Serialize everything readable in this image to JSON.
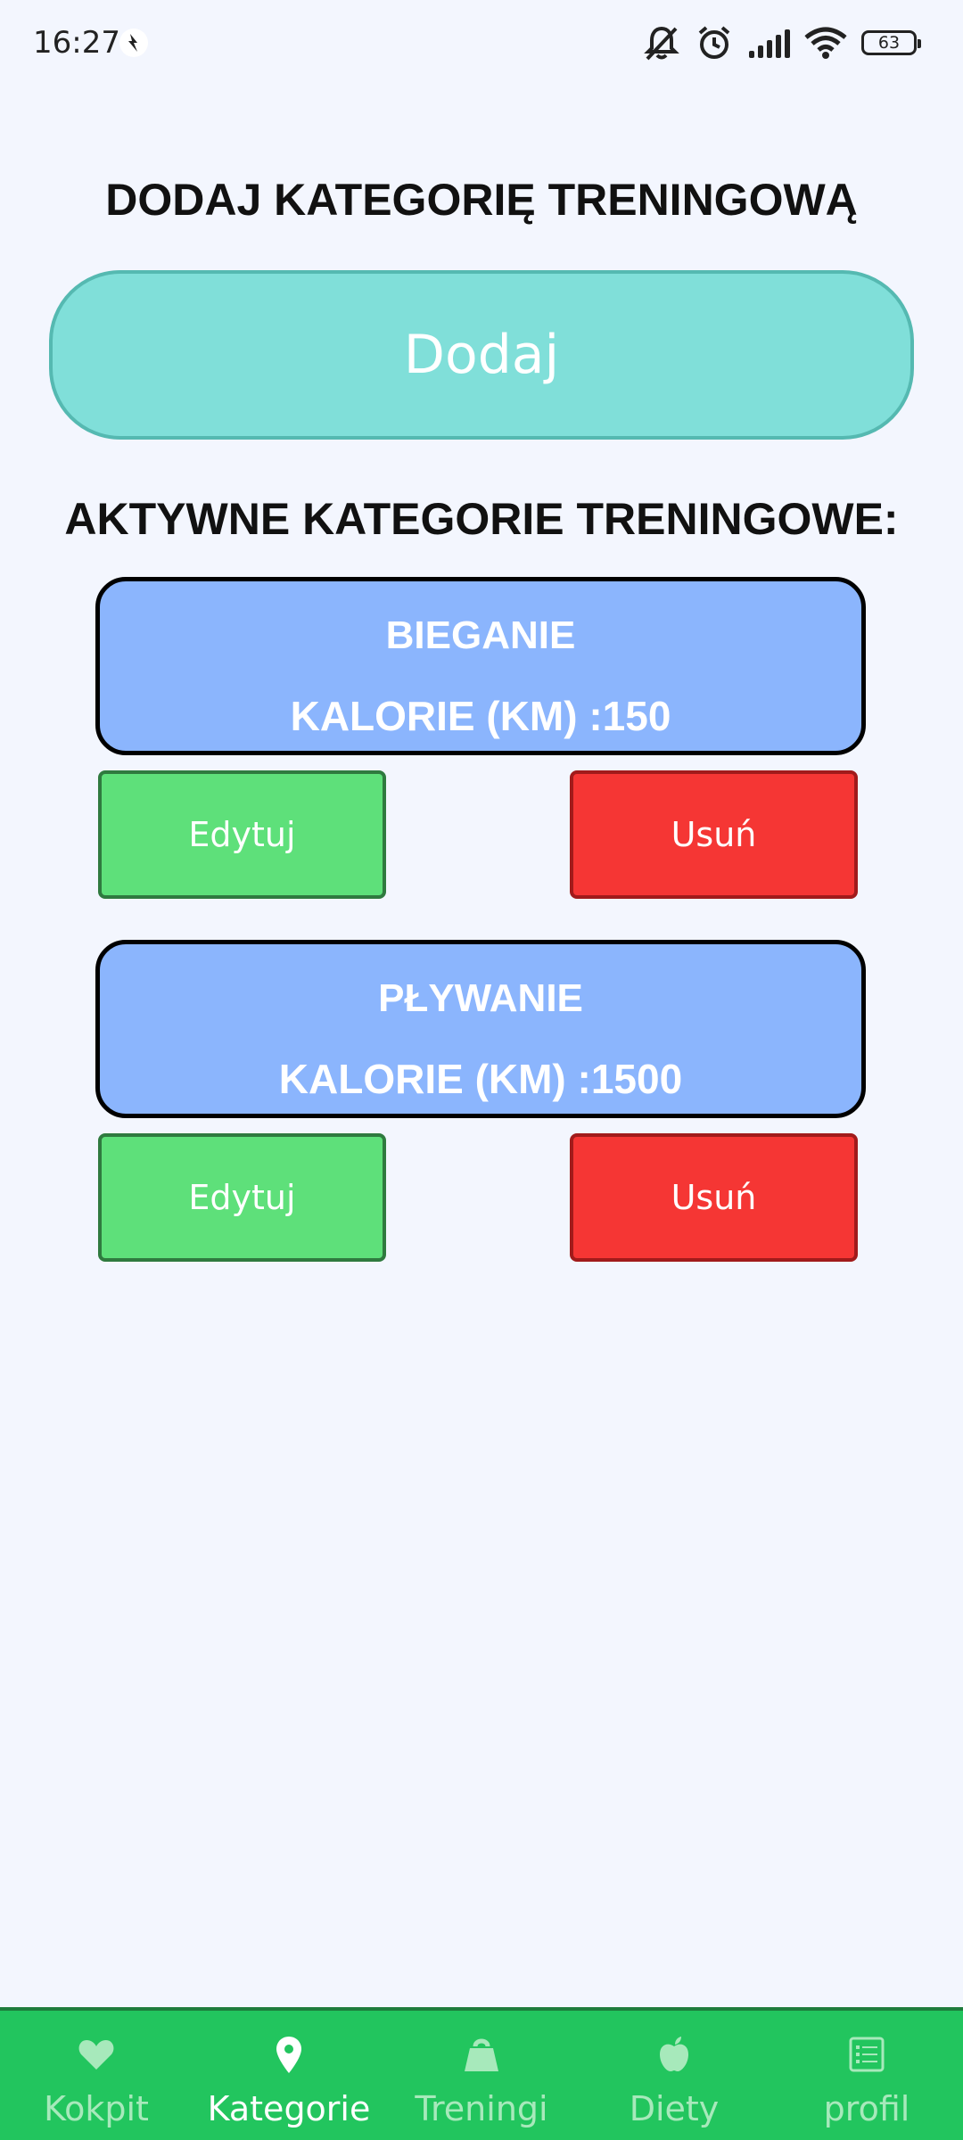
{
  "status_bar": {
    "time": "16:27",
    "battery": "63",
    "icons": [
      "notification-icon",
      "muted-bell-icon",
      "alarm-icon",
      "signal-icon",
      "wifi-icon",
      "battery-icon"
    ]
  },
  "add_section": {
    "heading": "DODAJ KATEGORIĘ TRENINGOWĄ",
    "button_label": "Dodaj"
  },
  "active_section": {
    "heading": "AKTYWNE KATEGORIE TRENINGOWE:",
    "categories": [
      {
        "name": "BIEGANIE",
        "calories": "KALORIE (KM) :150",
        "edit_label": "Edytuj",
        "delete_label": "Usuń"
      },
      {
        "name": "PŁYWANIE",
        "calories": "KALORIE (KM) :1500",
        "edit_label": "Edytuj",
        "delete_label": "Usuń"
      }
    ]
  },
  "bottom_nav": {
    "items": [
      {
        "label": "Kokpit",
        "icon": "heart-icon",
        "active": false
      },
      {
        "label": "Kategorie",
        "icon": "location-pin-icon",
        "active": true
      },
      {
        "label": "Treningi",
        "icon": "kettlebell-icon",
        "active": false
      },
      {
        "label": "Diety",
        "icon": "apple-icon",
        "active": false
      },
      {
        "label": "profil",
        "icon": "list-icon",
        "active": false
      }
    ]
  },
  "colors": {
    "background": "#f3f6fe",
    "add_button": "#80dfd9",
    "category_card": "#8bb5fd",
    "edit_button": "#5ee07a",
    "delete_button": "#f53634",
    "nav_bar": "#22c55e",
    "nav_inactive": "#a7e9bb",
    "nav_active": "#ffffff"
  }
}
